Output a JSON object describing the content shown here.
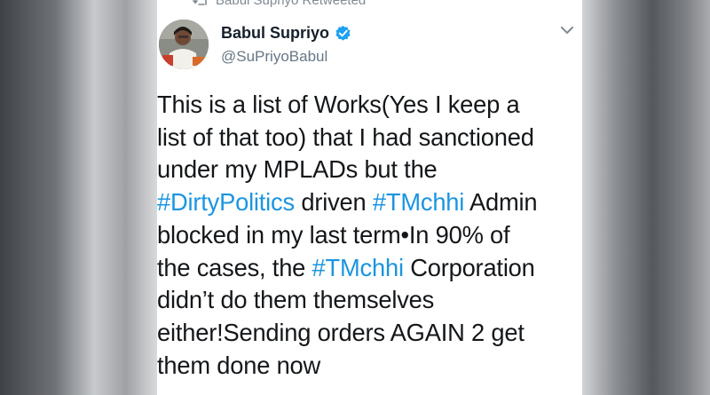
{
  "retweet": {
    "icon": "retweet-icon",
    "text": "Babul Supriyo Retweeted"
  },
  "author": {
    "name": "Babul Supriyo",
    "handle": "@SuPriyoBabul",
    "verified": true,
    "verified_color": "#1da1f2"
  },
  "menu": {
    "icon": "chevron-down-icon"
  },
  "tweet": {
    "line1": "This is a list of Works(Yes I keep a",
    "line2": "list of that too) that I had sanctioned",
    "line3": "under my MPLADs but the",
    "line4_tag1": "#DirtyPolitics",
    "line4_mid": " driven ",
    "line4_tag2": "#TMchhi",
    "line4_end": " Admin",
    "line5": "blocked in my last term•In 90% of",
    "line6_start": "the cases, the ",
    "line6_tag": "#TMchhi",
    "line6_end": " Corporation",
    "line7": "didn’t do them themselves",
    "line8": "either!Sending orders AGAIN 2 get",
    "line9": "them done now"
  },
  "colors": {
    "hashtag": "#1b95e0",
    "text": "#14171a",
    "secondary": "#657786"
  }
}
